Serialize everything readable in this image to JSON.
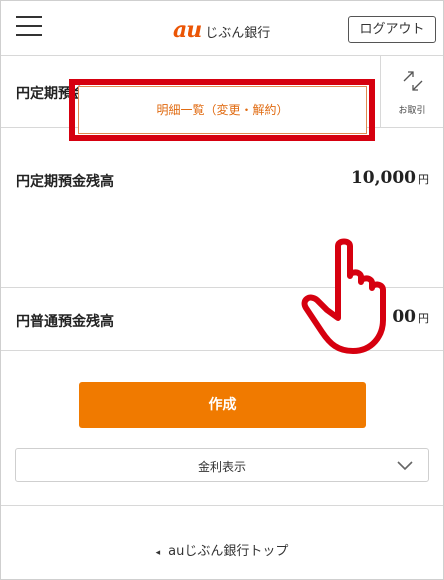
{
  "header": {
    "logo_mark": "au",
    "logo_text": "じぶん銀行",
    "logout_label": "ログアウト",
    "menu_icon": "hamburger-menu-icon"
  },
  "title_row": {
    "title": "円定期預金",
    "transaction_label": "お取引",
    "transaction_icon": "swap-arrows-icon"
  },
  "time_deposit": {
    "label": "円定期預金残高",
    "amount": "10,000",
    "unit": "円",
    "detail_button": "明細一覧（変更・解約）"
  },
  "ordinary_deposit": {
    "label": "円普通預金残高",
    "amount_visible": "00",
    "unit": "円"
  },
  "actions": {
    "create_label": "作成",
    "rate_select_value": "金利表示"
  },
  "footer": {
    "back_arrow": "◂",
    "top_link": "auじぶん銀行トップ"
  },
  "colors": {
    "brand_orange": "#f07a00",
    "highlight_red": "#d6000f",
    "logo_orange": "#eb5505"
  }
}
